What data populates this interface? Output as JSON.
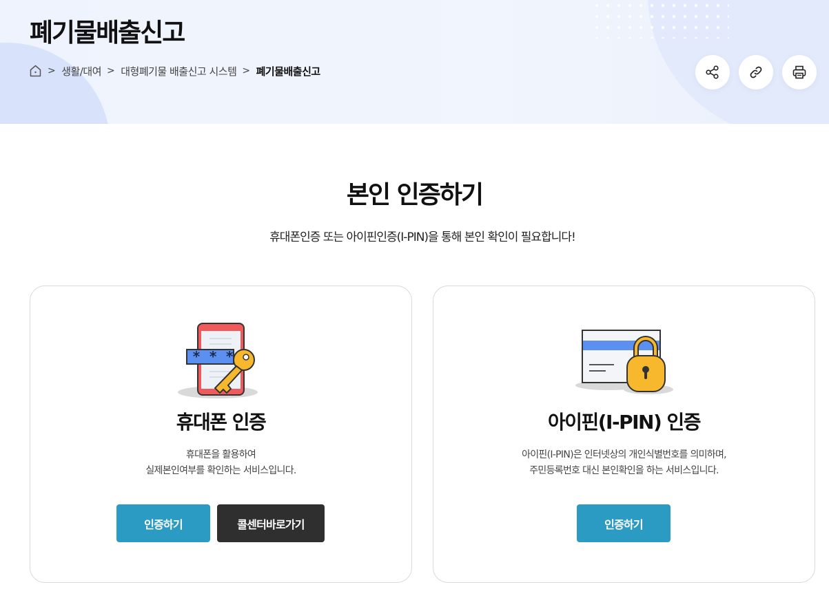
{
  "header": {
    "title": "폐기물배출신고",
    "breadcrumb": [
      "생활/대여",
      "대형폐기물 배출신고 시스템",
      "폐기물배출신고"
    ],
    "tools": [
      "share-icon",
      "link-icon",
      "print-icon"
    ]
  },
  "main": {
    "title": "본인 인증하기",
    "subtitle": "휴대폰인증 또는 아이핀인증(I-PIN)을 통해 본인 확인이 필요합니다!",
    "cards": [
      {
        "icon": "phone-key-icon",
        "title": "휴대폰 인증",
        "desc_line1": "휴대폰을 활용하여",
        "desc_line2": "실제본인여부를 확인하는 서비스입니다.",
        "primary_button": "인증하기",
        "secondary_button": "콜센터바로가기"
      },
      {
        "icon": "ipin-lock-icon",
        "title": "아이핀(I-PIN) 인증",
        "desc_line1": "아이핀(I-PIN)은 인터넷상의 개인식별번호를 의미하며,",
        "desc_line2": "주민등록번호 대신 본인확인을 하는 서비스입니다.",
        "primary_button": "인증하기"
      }
    ]
  },
  "colors": {
    "accent": "#2c9bc4",
    "dark_button": "#2f2f2f",
    "banner_bg": "#eef3fd",
    "phone_red": "#f15a5a",
    "key_yellow": "#f7b82e",
    "card_blue": "#5b8ff0"
  }
}
